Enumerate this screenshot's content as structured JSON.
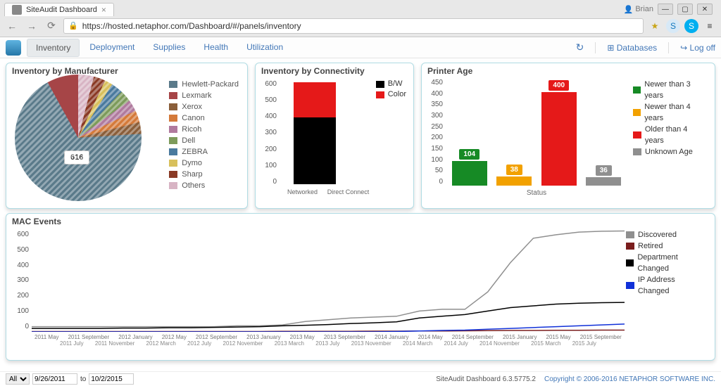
{
  "browser": {
    "tab_title": "SiteAudit Dashboard",
    "url": "https://hosted.netaphor.com/Dashboard/#/panels/inventory",
    "user": "Brian"
  },
  "nav": {
    "tabs": [
      "Inventory",
      "Deployment",
      "Supplies",
      "Health",
      "Utilization"
    ],
    "active": 0,
    "refresh": "↻",
    "databases": "Databases",
    "logoff": "Log off"
  },
  "panel_manufacturer": {
    "title": "Inventory by Manufacturer",
    "callout": "616",
    "legend": [
      {
        "label": "Hewlett-Packard",
        "color": "#5a7a8a"
      },
      {
        "label": "Lexmark",
        "color": "#a64547"
      },
      {
        "label": "Xerox",
        "color": "#8a5e3a"
      },
      {
        "label": "Canon",
        "color": "#d47a3a"
      },
      {
        "label": "Ricoh",
        "color": "#b07a9e"
      },
      {
        "label": "Dell",
        "color": "#7d9b5b"
      },
      {
        "label": "ZEBRA",
        "color": "#4a7a9e"
      },
      {
        "label": "Dymo",
        "color": "#d8c05c"
      },
      {
        "label": "Sharp",
        "color": "#8a3a25"
      },
      {
        "label": "Others",
        "color": "#d8b4c4"
      }
    ]
  },
  "panel_connectivity": {
    "title": "Inventory by Connectivity",
    "legend": [
      {
        "label": "B/W",
        "color": "#000000"
      },
      {
        "label": "Color",
        "color": "#e51919"
      }
    ],
    "xlabels": [
      "Networked",
      "Direct Connect"
    ]
  },
  "panel_age": {
    "title": "Printer Age",
    "xlabel": "Status",
    "legend": [
      {
        "label": "Newer than 3 years",
        "color": "#168a25"
      },
      {
        "label": "Newer than 4 years",
        "color": "#f2a100"
      },
      {
        "label": "Older than 4 years",
        "color": "#e51919"
      },
      {
        "label": "Unknown Age",
        "color": "#8f8f8f"
      }
    ]
  },
  "panel_mac": {
    "title": "MAC Events",
    "legend": [
      {
        "label": "Discovered",
        "color": "#8f8f8f"
      },
      {
        "label": "Retired",
        "color": "#7a1d1d"
      },
      {
        "label": "Department Changed",
        "color": "#000000"
      },
      {
        "label": "IP Address Changed",
        "color": "#1030d8"
      }
    ],
    "xlabels_top": [
      "2011 May",
      "2011 September",
      "2012 January",
      "2012 May",
      "2012 September",
      "2013 January",
      "2013 May",
      "2013 September",
      "2014 January",
      "2014 May",
      "2014 September",
      "2015 January",
      "2015 May",
      "2015 September"
    ],
    "xlabels_bottom": [
      "2011 July",
      "2011 November",
      "2012 March",
      "2012 July",
      "2012 November",
      "2013 March",
      "2013 July",
      "2013 November",
      "2014 March",
      "2014 July",
      "2014 November",
      "2015 March",
      "2015 July"
    ]
  },
  "footer": {
    "all": "All",
    "from": "9/26/2011",
    "to_label": "to",
    "to": "10/2/2015",
    "brand": "SiteAudit Dashboard 6.3.5775.2",
    "copy": "Copyright © 2006-2016 NETAPHOR SOFTWARE INC."
  },
  "chart_data": [
    {
      "type": "pie",
      "title": "Inventory by Manufacturer",
      "series": [
        {
          "name": "Hewlett-Packard",
          "value": 616
        },
        {
          "name": "Lexmark",
          "value": 70
        },
        {
          "name": "Xerox",
          "value": 30
        },
        {
          "name": "Canon",
          "value": 30
        },
        {
          "name": "Ricoh",
          "value": 30
        },
        {
          "name": "Dell",
          "value": 30
        },
        {
          "name": "ZEBRA",
          "value": 30
        },
        {
          "name": "Dymo",
          "value": 20
        },
        {
          "name": "Sharp",
          "value": 25
        },
        {
          "name": "Others",
          "value": 35
        }
      ]
    },
    {
      "type": "bar",
      "title": "Inventory by Connectivity",
      "categories": [
        "Networked",
        "Direct Connect"
      ],
      "series": [
        {
          "name": "B/W",
          "values": [
            380,
            0
          ]
        },
        {
          "name": "Color",
          "values": [
            200,
            0
          ]
        }
      ],
      "ylim": [
        0,
        600
      ],
      "yticks": [
        0,
        100,
        200,
        300,
        400,
        500,
        600
      ],
      "stacked": true
    },
    {
      "type": "bar",
      "title": "Printer Age",
      "xlabel": "Status",
      "categories": [
        "Newer than 3 years",
        "Newer than 4 years",
        "Older than 4 years",
        "Unknown Age"
      ],
      "values": [
        104,
        38,
        400,
        36
      ],
      "colors": [
        "#168a25",
        "#f2a100",
        "#e51919",
        "#8f8f8f"
      ],
      "ylim": [
        0,
        450
      ],
      "yticks": [
        0,
        50,
        100,
        150,
        200,
        250,
        300,
        350,
        400,
        450
      ]
    },
    {
      "type": "line",
      "title": "MAC Events",
      "x": [
        "2011 May",
        "2011 July",
        "2011 September",
        "2011 November",
        "2012 January",
        "2012 March",
        "2012 May",
        "2012 July",
        "2012 September",
        "2012 November",
        "2013 January",
        "2013 March",
        "2013 May",
        "2013 July",
        "2013 September",
        "2013 November",
        "2014 January",
        "2014 March",
        "2014 May",
        "2014 July",
        "2014 September",
        "2014 November",
        "2015 January",
        "2015 March",
        "2015 May",
        "2015 July",
        "2015 September"
      ],
      "series": [
        {
          "name": "Discovered",
          "color": "#8f8f8f",
          "values": [
            30,
            30,
            30,
            30,
            30,
            30,
            30,
            30,
            30,
            35,
            35,
            40,
            60,
            70,
            80,
            85,
            90,
            120,
            130,
            130,
            230,
            400,
            540,
            560,
            575,
            580,
            582
          ]
        },
        {
          "name": "Retired",
          "color": "#7a1d1d",
          "values": [
            2,
            2,
            2,
            2,
            2,
            2,
            2,
            2,
            2,
            2,
            2,
            3,
            3,
            3,
            3,
            4,
            4,
            5,
            5,
            6,
            7,
            8,
            8,
            9,
            9,
            10,
            10
          ]
        },
        {
          "name": "Department Changed",
          "color": "#000000",
          "values": [
            20,
            20,
            20,
            20,
            22,
            22,
            24,
            24,
            26,
            28,
            30,
            35,
            38,
            42,
            48,
            52,
            58,
            80,
            90,
            100,
            120,
            140,
            150,
            160,
            165,
            168,
            170
          ]
        },
        {
          "name": "IP Address Changed",
          "color": "#1030d8",
          "values": [
            0,
            0,
            0,
            0,
            0,
            0,
            0,
            0,
            0,
            0,
            0,
            0,
            0,
            0,
            0,
            0,
            2,
            5,
            8,
            10,
            15,
            20,
            25,
            30,
            35,
            40,
            45
          ]
        }
      ],
      "ylim": [
        0,
        600
      ],
      "yticks": [
        0,
        100,
        200,
        300,
        400,
        500,
        600
      ]
    }
  ]
}
